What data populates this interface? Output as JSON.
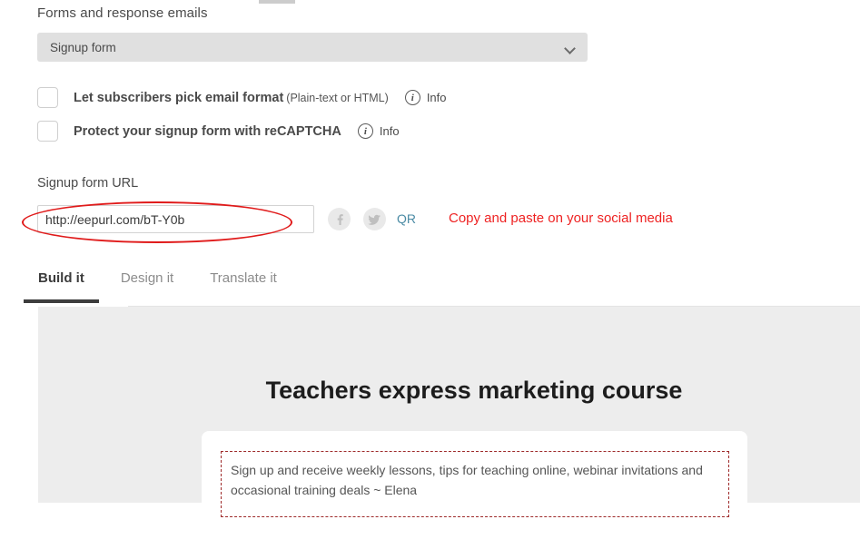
{
  "section": {
    "label": "Forms and response emails",
    "form_select": {
      "value": "Signup form",
      "chevron": "chevron-down-icon"
    }
  },
  "options": [
    {
      "label": "Let subscribers pick email format",
      "sublabel": "(Plain-text or HTML)",
      "checked": false,
      "info_label": "Info",
      "info_icon": "info-circle-icon"
    },
    {
      "label": "Protect your signup form with reCAPTCHA",
      "sublabel": "",
      "checked": false,
      "info_label": "Info",
      "info_icon": "info-circle-icon"
    }
  ],
  "url_section": {
    "label": "Signup form URL",
    "url_value": "http://eepurl.com/bT-Y0b",
    "url_placeholder": "http://eepurl.com/",
    "facebook_icon": "facebook-icon",
    "twitter_icon": "twitter-icon",
    "qr_label": "QR",
    "annotation_note": "Copy and paste on your social media",
    "annotation_color": "#ee2222",
    "ellipse_color": "#e01b1b"
  },
  "tabs": [
    {
      "label": "Build it",
      "active": true
    },
    {
      "label": "Design it",
      "active": false
    },
    {
      "label": "Translate it",
      "active": false
    }
  ],
  "preview": {
    "title": "Teachers express marketing course",
    "description": "Sign up and receive weekly lessons, tips for teaching online, webinar invitations and occasional training deals ~ Elena",
    "dashed_border_color": "#9e2a2a",
    "panel_bg": "#ededed"
  }
}
